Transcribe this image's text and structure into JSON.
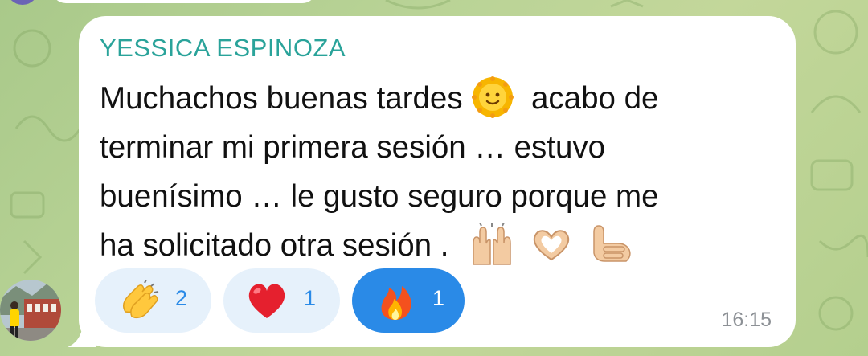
{
  "chat": {
    "sender_name": "YESSICA ESPINOZA",
    "message_lines": [
      "Muchachos buenas tardes",
      "acabo de",
      "terminar mi primera sesión … estuvo",
      "buenísimo … le gusto seguro porque me",
      "ha solicitado otra sesión ."
    ],
    "time": "16:15",
    "reactions": [
      {
        "emoji": "clapping-hands",
        "count": "2",
        "active": false
      },
      {
        "emoji": "red-heart",
        "count": "1",
        "active": false
      },
      {
        "emoji": "fire",
        "count": "1",
        "active": true
      }
    ]
  },
  "colors": {
    "sender_name": "#2aa39a",
    "reaction_bg": "#e6f1fb",
    "reaction_active_bg": "#2a8ae7",
    "reaction_count": "#2a8ae7",
    "time": "#8d9196",
    "wallpaper": "#b9d396",
    "bubble": "#ffffff"
  },
  "icons": {
    "inline": [
      "sun-with-face-emoji",
      "raising-hands-emoji",
      "heart-hands-emoji",
      "call-me-hand-emoji"
    ]
  }
}
